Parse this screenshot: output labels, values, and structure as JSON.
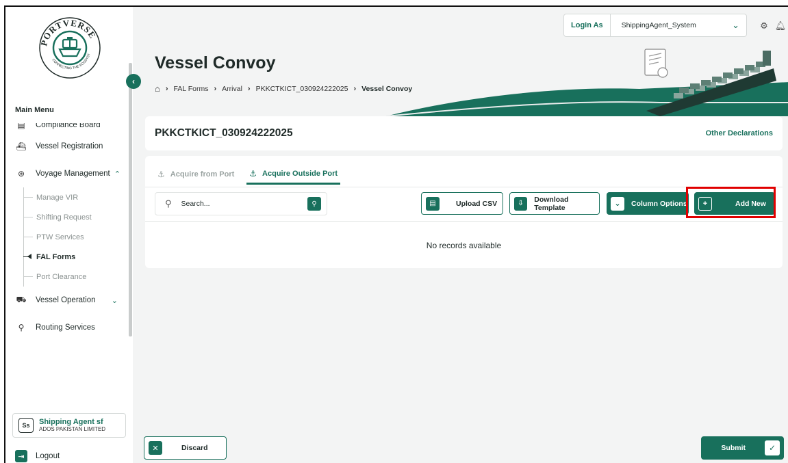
{
  "brand": {
    "logo_text": "PORTVERSE",
    "logo_tagline": "CONNECTING THE ECOSYSTEM",
    "accent": "#18705c",
    "highlight": "#e00000"
  },
  "topbar": {
    "login_as_label": "Login As",
    "login_as_value": "ShippingAgent_System",
    "settings_icon": "gear-icon",
    "notify_icon": "bell-icon"
  },
  "sidebar": {
    "main_menu_label": "Main Menu",
    "items": [
      {
        "label": "Compliance Board",
        "icon": "clipboard-icon"
      },
      {
        "label": "Vessel Registration",
        "icon": "ship-icon"
      },
      {
        "label": "Voyage Management",
        "icon": "compass-icon"
      },
      {
        "label": "Vessel Operation",
        "icon": "vessel-icon"
      },
      {
        "label": "Routing Services",
        "icon": "route-icon"
      }
    ],
    "voyage_sub": [
      {
        "label": "Manage VIR"
      },
      {
        "label": "Shifting Request"
      },
      {
        "label": "PTW Services"
      },
      {
        "label": "FAL Forms"
      },
      {
        "label": "Port Clearance"
      }
    ],
    "user": {
      "initials": "Ss",
      "name": "Shipping Agent sf",
      "org": "ADOS PAKISTAN LIMITED"
    },
    "logout_label": "Logout"
  },
  "header": {
    "title": "Vessel Convoy",
    "breadcrumb": [
      "FAL Forms",
      "Arrival",
      "PKKCTKICT_030924222025",
      "Vessel Convoy"
    ]
  },
  "voyage": {
    "id": "PKKCTKICT_030924222025",
    "other_declarations": "Other Declarations"
  },
  "tabs": [
    {
      "label": "Acquire from Port"
    },
    {
      "label": "Acquire Outside Port"
    }
  ],
  "toolbar": {
    "search_placeholder": "Search...",
    "upload_csv": "Upload CSV",
    "download_template": "Download Template",
    "column_options": "Column Options",
    "add_new": "Add New"
  },
  "table": {
    "empty_message": "No records available"
  },
  "footer": {
    "discard": "Discard",
    "submit": "Submit"
  }
}
